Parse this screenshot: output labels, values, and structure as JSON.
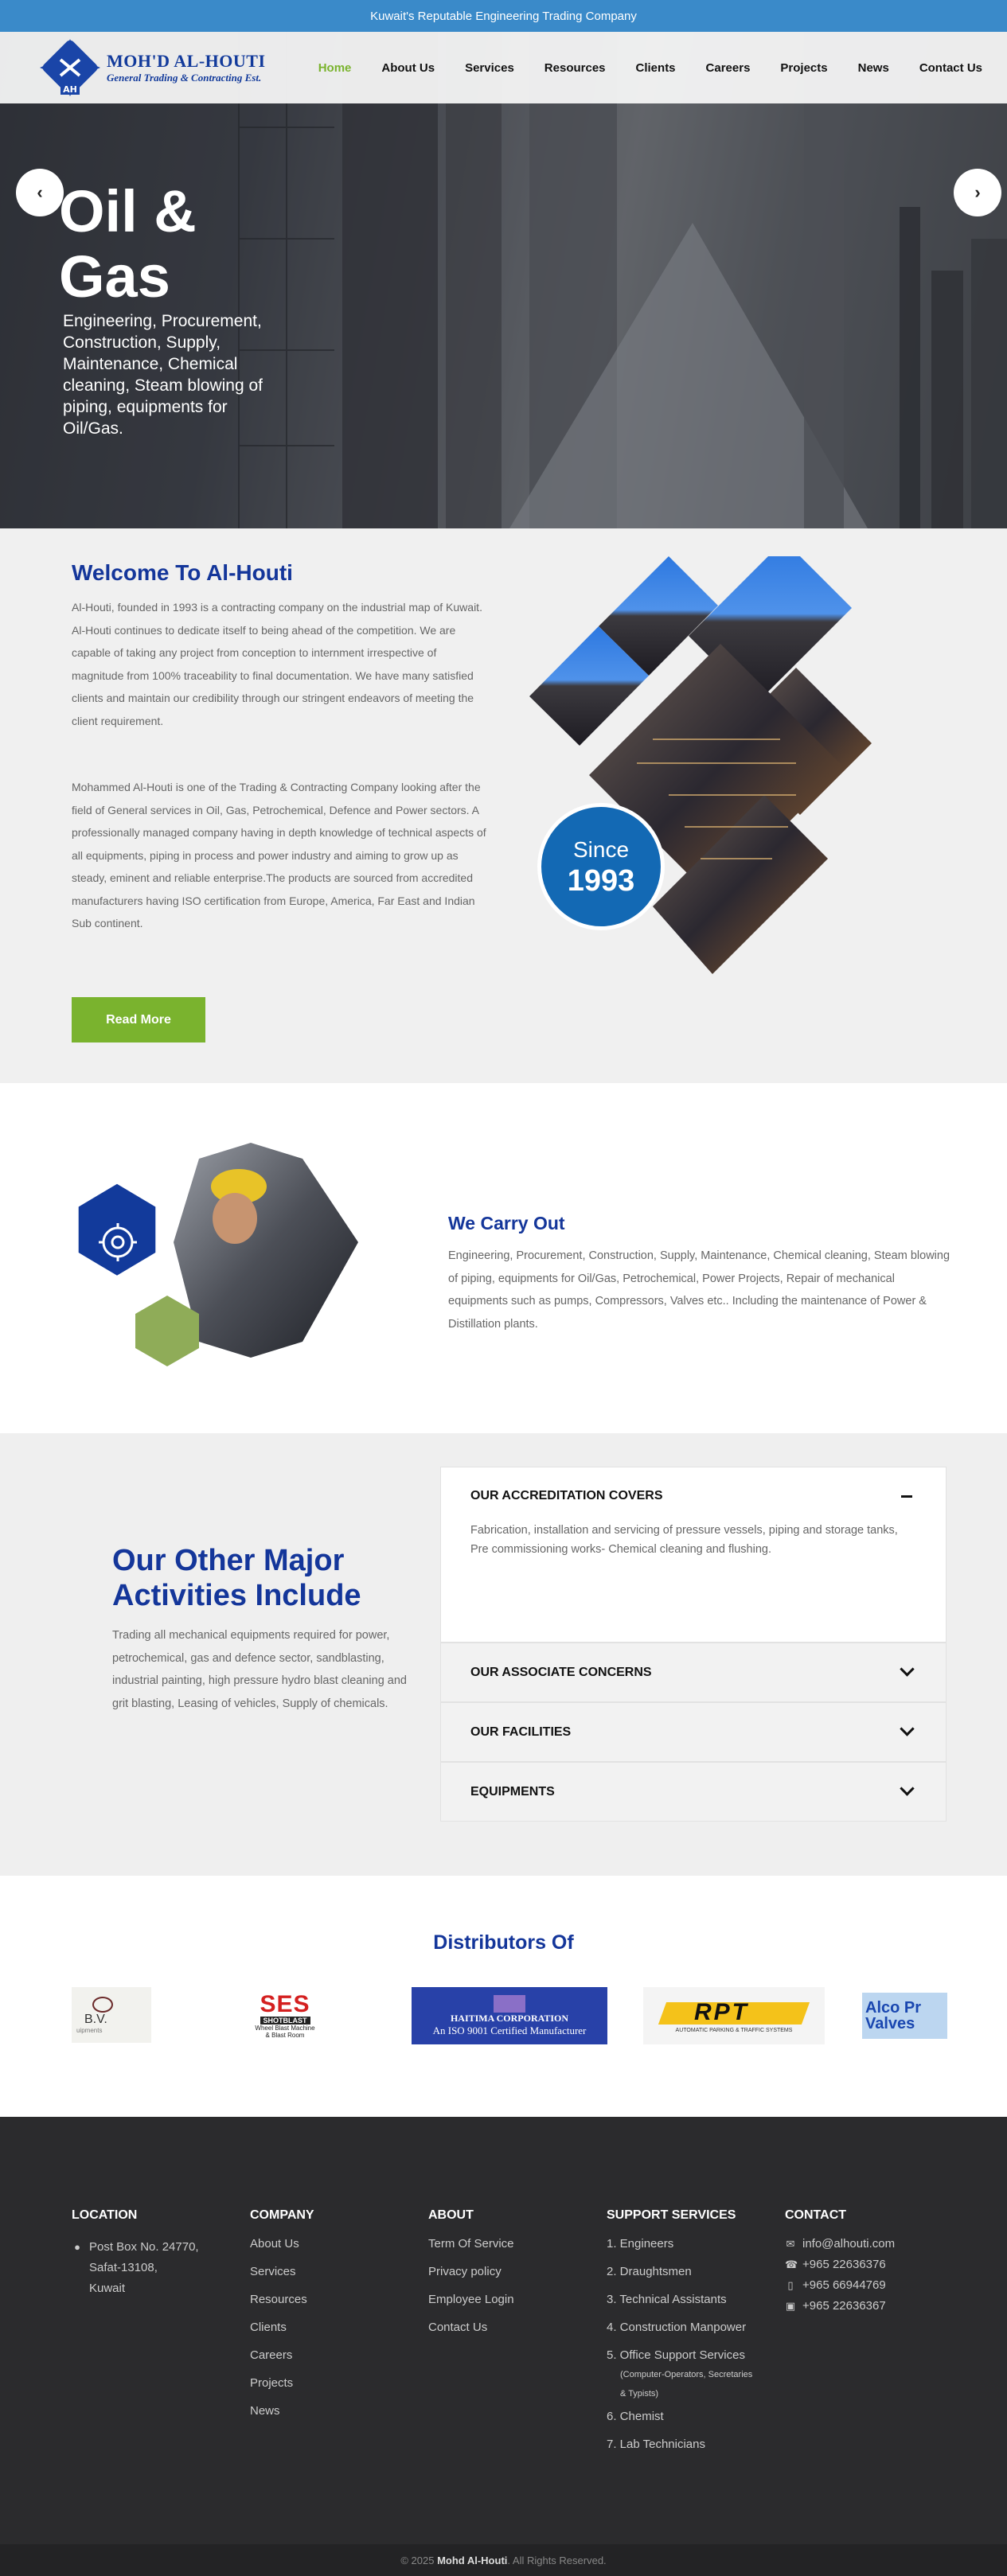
{
  "topbar": {
    "text": "Kuwait's Reputable Engineering Trading Company"
  },
  "logo": {
    "line1": "MOH'D AL-HOUTI",
    "line2": "General Trading & Contracting Est.",
    "mark": "AH"
  },
  "nav": [
    "Home",
    "About Us",
    "Services",
    "Resources",
    "Clients",
    "Careers",
    "Projects",
    "News",
    "Contact Us"
  ],
  "hero": {
    "title": "Oil & Gas",
    "text": "Engineering, Procurement, Construction, Supply, Maintenance, Chemical cleaning, Steam blowing of piping, equipments for Oil/Gas.",
    "prev": "‹",
    "next": "›"
  },
  "welcome": {
    "title": "Welcome To Al-Houti",
    "p1": "Al-Houti, founded in 1993 is a contracting company on the industrial map of Kuwait. Al-Houti continues to dedicate itself to being ahead of the competition. We are capable of taking any project from conception to internment irrespective of magnitude from 100% traceability to final documentation. We have many satisfied clients and maintain our credibility through our stringent endeavors of meeting the client requirement.",
    "p2": "Mohammed  Al-Houti is one of the Trading & Contracting Company looking after the field of General services in Oil, Gas, Petrochemical, Defence and Power sectors. A professionally managed company having in depth knowledge of technical aspects of all equipments, piping in process and power industry and aiming to grow up as steady, eminent and reliable enterprise.The products are sourced from accredited manufacturers having ISO certification from Europe, America, Far East and Indian Sub continent.",
    "button": "Read More",
    "since_label": "Since",
    "since_year": "1993"
  },
  "carry": {
    "title": "We Carry Out",
    "text": "Engineering, Procurement, Construction, Supply, Maintenance, Chemical cleaning, Steam blowing of piping, equipments for Oil/Gas, Petrochemical, Power Projects, Repair of mechanical equipments such as pumps, Compressors, Valves etc.. Including the maintenance of Power & Distillation plants."
  },
  "activities": {
    "title": "Our Other Major Activities Include",
    "text": "Trading all mechanical equipments required for power, petrochemical, gas and defence sector, sandblasting, industrial painting, high pressure hydro blast cleaning and grit blasting, Leasing of vehicles, Supply of chemicals.",
    "accordion": [
      {
        "title": "OUR ACCREDITATION COVERS",
        "body": "Fabrication, installation and servicing of pressure vessels, piping and storage tanks, Pre commissioning works- Chemical cleaning and flushing."
      },
      {
        "title": "OUR ASSOCIATE CONCERNS"
      },
      {
        "title": "OUR FACILITIES"
      },
      {
        "title": "EQUIPMENTS"
      }
    ]
  },
  "distributors": {
    "title": "Distributors Of",
    "logos": [
      {
        "text": "B.V.",
        "sub": "uipments"
      },
      {
        "text": "SES",
        "sub": "SHOTBLAST",
        "sub2": "Wheel Blast Machine & Blast Room"
      },
      {
        "text": "HAITIMA CORPORATION",
        "sub": "An ISO 9001 Certified Manufacturer"
      },
      {
        "text": "RPT",
        "sub": "AUTOMATIC PARKING & TRAFFIC SYSTEMS"
      },
      {
        "text": "Alco Pr Valves"
      }
    ]
  },
  "footer": {
    "location": {
      "title": "LOCATION",
      "lines": [
        "Post Box No. 24770,",
        "Safat-13108,",
        "Kuwait"
      ]
    },
    "company": {
      "title": "COMPANY",
      "links": [
        "About Us",
        "Services",
        "Resources",
        "Clients",
        "Careers",
        "Projects",
        "News"
      ]
    },
    "about": {
      "title": "ABOUT",
      "links": [
        "Term Of Service",
        "Privacy policy",
        "Employee Login",
        "Contact Us"
      ]
    },
    "support": {
      "title": "SUPPORT SERVICES",
      "items": [
        "1. Engineers",
        "2. Draughtsmen",
        "3. Technical Assistants",
        "4. Construction Manpower",
        "5. Office Support Services"
      ],
      "note1": "(Computer-Operators, Secretaries",
      "note2": "& Typists)",
      "items2": [
        "6. Chemist",
        "7. Lab Technicians"
      ]
    },
    "contact": {
      "title": "CONTACT",
      "email": "info@alhouti.com",
      "phone": "+965 22636376",
      "mobile": "+965 66944769",
      "fax": "+965 22636367"
    },
    "copyright_pre": "© 2025",
    "copyright_name": "Mohd Al-Houti",
    "copyright_post": ". All Rights Reserved."
  },
  "colors": {
    "primary": "#14369a",
    "accent": "#7ab32e",
    "topbar": "#3a8ac9",
    "footer": "#2b2b2d"
  }
}
